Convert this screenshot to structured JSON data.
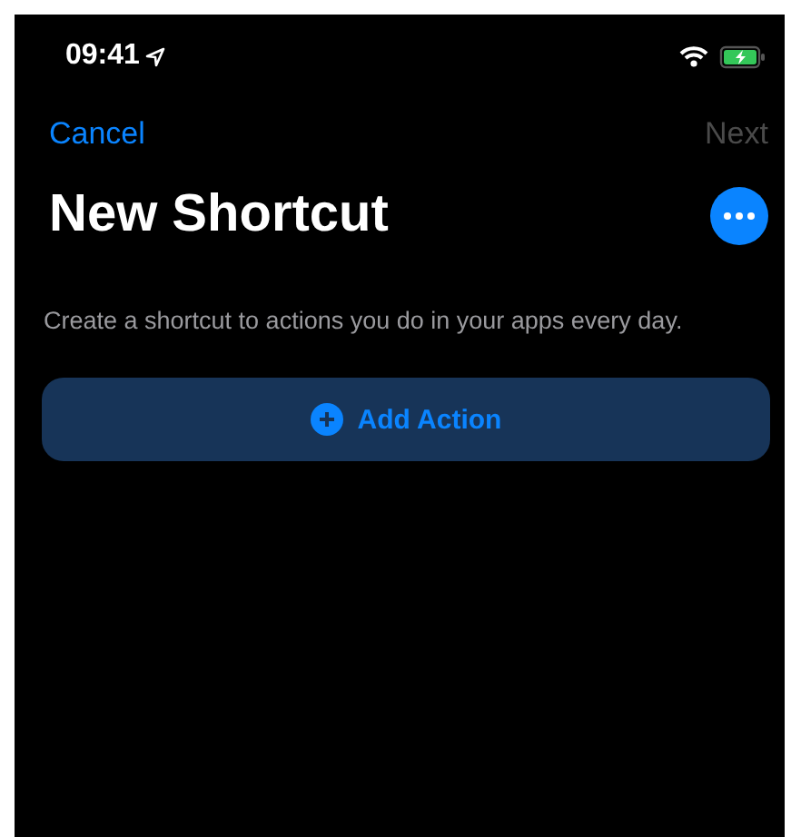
{
  "status_bar": {
    "time": "09:41"
  },
  "nav": {
    "cancel": {
      "label": "Cancel",
      "disabled": false
    },
    "next": {
      "label": "Next",
      "disabled": true
    }
  },
  "title": "New Shortcut",
  "description": "Create a shortcut to actions you do in your apps every day.",
  "add_action": {
    "label": "Add Action"
  }
}
